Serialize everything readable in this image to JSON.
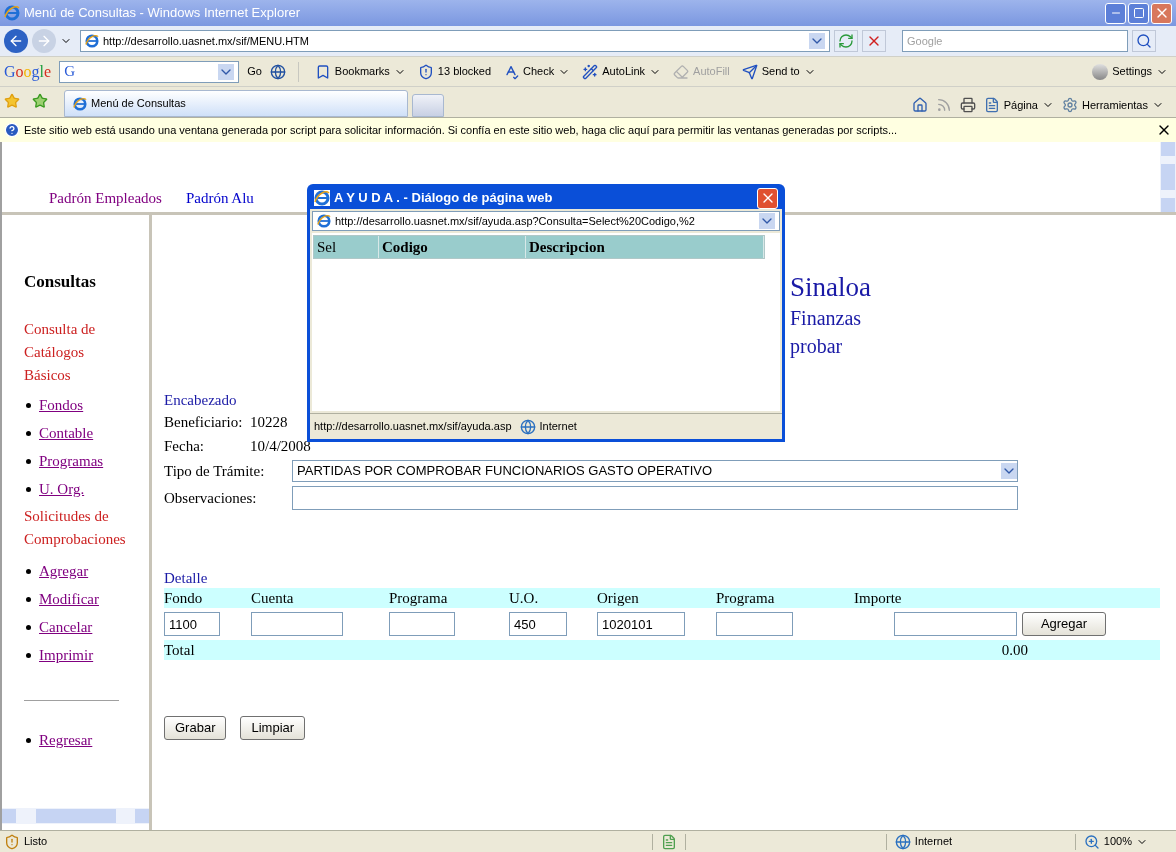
{
  "window": {
    "title": "Menú de Consultas - Windows Internet Explorer"
  },
  "address_bar": {
    "url": "http://desarrollo.uasnet.mx/sif/MENU.HTM",
    "search_placeholder": "Google"
  },
  "google_toolbar": {
    "logo": "Google",
    "search_logo": "G",
    "items": [
      {
        "label": "Go",
        "disabled": false
      },
      {
        "label": "Bookmarks",
        "disabled": false
      },
      {
        "label": "13 blocked",
        "disabled": false
      },
      {
        "label": "Check",
        "disabled": false
      },
      {
        "label": "AutoLink",
        "disabled": false
      },
      {
        "label": "AutoFill",
        "disabled": true
      },
      {
        "label": "Send to",
        "disabled": false
      }
    ],
    "settings": "Settings"
  },
  "tabs": [
    {
      "label": "Menú de Consultas",
      "selected": true
    }
  ],
  "command_bar": [
    "Página",
    "Herramientas"
  ],
  "info_bar": "Este sitio web está usando una ventana generada por script para solicitar información. Si confía en este sitio web, haga clic aquí para permitir las ventanas generadas por scripts...",
  "top_menu": [
    {
      "label": "Padrón Empleados",
      "visited": true
    },
    {
      "label": "Padrón Alu",
      "visited": false
    }
  ],
  "sidebar": {
    "title": "Consultas",
    "sections": [
      {
        "heading": "Consulta de Catálogos Básicos",
        "links": [
          {
            "label": "Fondos",
            "visited": true
          },
          {
            "label": "Contable",
            "visited": true
          },
          {
            "label": "Programas",
            "visited": true
          },
          {
            "label": "U. Org.",
            "visited": true
          }
        ]
      },
      {
        "heading": "Solicitudes de Comprobaciones",
        "links": [
          {
            "label": "Agregar",
            "visited": true
          },
          {
            "label": "Modificar",
            "visited": true
          },
          {
            "label": "Cancelar",
            "visited": true
          },
          {
            "label": "Imprimir",
            "visited": true
          }
        ]
      }
    ],
    "footer_links": [
      {
        "label": "Regresar",
        "visited": true
      }
    ]
  },
  "heading_lines": [
    "Sinaloa",
    "Finanzas",
    "probar"
  ],
  "form": {
    "section": "Encabezado",
    "beneficiario_label": "Beneficiario:",
    "beneficiario": "10228",
    "fecha_label": "Fecha:",
    "fecha": "10/4/2008",
    "tipo_label": "Tipo de Trámite:",
    "tipo": "PARTIDAS POR COMPROBAR FUNCIONARIOS GASTO OPERATIVO",
    "observaciones_label": "Observaciones:"
  },
  "detail": {
    "title": "Detalle",
    "columns": [
      {
        "label": "Fondo",
        "value": "1100"
      },
      {
        "label": "Cuenta"
      },
      {
        "label": "Programa"
      },
      {
        "label": "U.O.",
        "value": "450"
      },
      {
        "label": "Origen",
        "value": "1020101"
      },
      {
        "label": "Programa"
      },
      {
        "label": "Importe"
      }
    ],
    "add_button": "Agregar",
    "total_label": "Total",
    "total": "0.00"
  },
  "buttons": [
    "Grabar",
    "Limpiar"
  ],
  "status_bar": {
    "text": "Listo",
    "zone": "Internet",
    "zoom": "100%"
  },
  "dialog": {
    "title": "A Y U D A . - Diálogo de página web",
    "url": "http://desarrollo.uasnet.mx/sif/ayuda.asp?Consulta=Select%20Codigo,%2",
    "columns": [
      "Sel",
      "Codigo",
      "Descripcion"
    ],
    "status_url": "http://desarrollo.uasnet.mx/sif/ayuda.asp",
    "zone": "Internet"
  }
}
